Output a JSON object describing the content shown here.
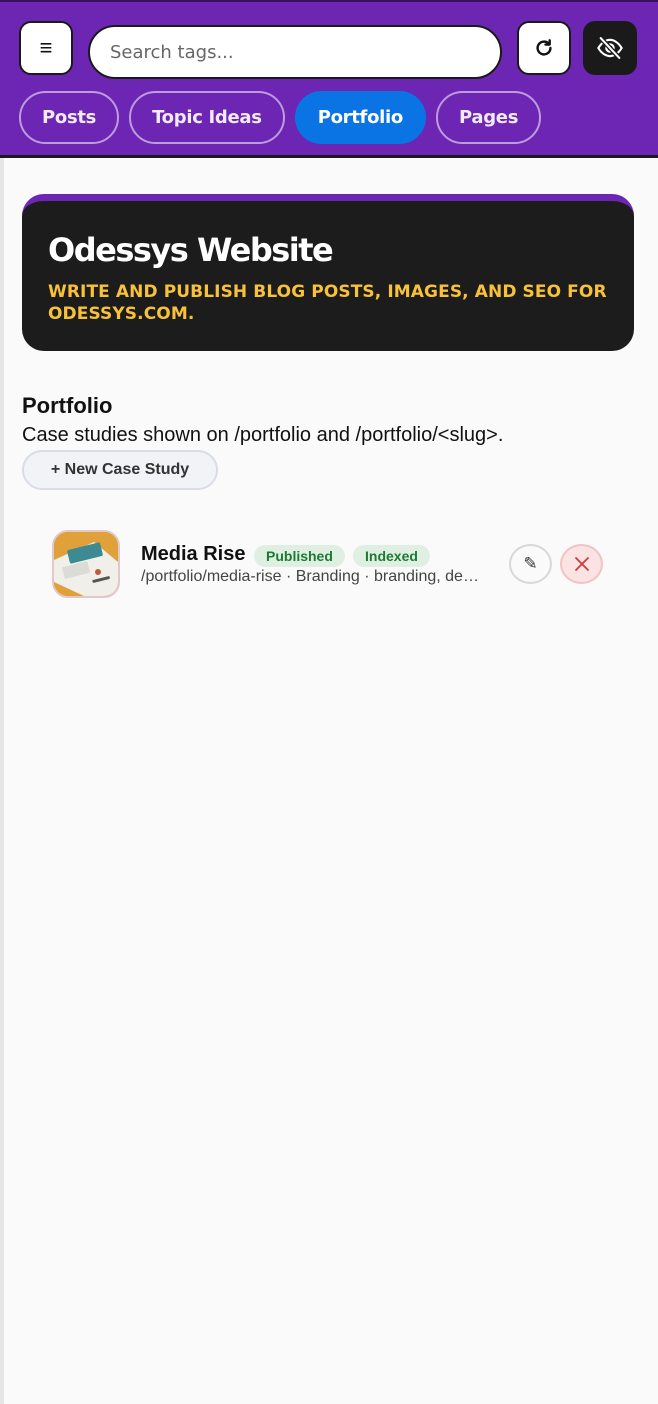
{
  "header": {
    "menu_icon": "menu-icon",
    "search_placeholder": "Search tags...",
    "refresh_icon": "refresh-icon",
    "visibility_icon": "eye-off-icon",
    "tabs": [
      {
        "label": "Posts",
        "active": false
      },
      {
        "label": "Topic Ideas",
        "active": false
      },
      {
        "label": "Portfolio",
        "active": true
      },
      {
        "label": "Pages",
        "active": false
      }
    ]
  },
  "banner": {
    "title": "Odessys Website",
    "subtitle": "Write and publish blog posts, images, and SEO for odessys.com."
  },
  "section": {
    "title": "Portfolio",
    "description": "Case studies shown on /portfolio and /portfolio/<slug>.",
    "new_button_label": "+ New Case Study"
  },
  "items": [
    {
      "title": "Media Rise",
      "badges": [
        "Published",
        "Indexed"
      ],
      "meta": "/portfolio/media-rise · Branding · branding, design, identity"
    }
  ],
  "colors": {
    "header_bg": "#6d25b4",
    "active_tab": "#0b74e5",
    "banner_bg": "#1c1c1c",
    "banner_subtitle": "#f7c13a",
    "badge_bg": "#dff0e2",
    "badge_text": "#1c7a34",
    "delete_accent": "#d03a3a"
  }
}
